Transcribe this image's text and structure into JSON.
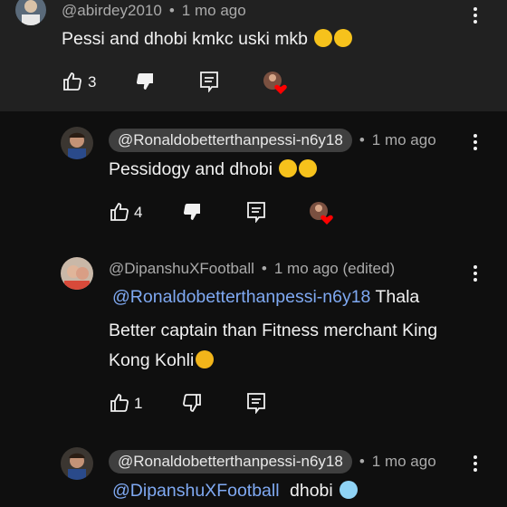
{
  "comment_top": {
    "author": "@abirdey2010",
    "time": "1 mo ago",
    "text": "Pessi and dhobi kmkc uski mkb",
    "likes": "3",
    "emojis": "laughing-crying x2"
  },
  "reply1": {
    "author": "@Ronaldobetterthanpessi-n6y18",
    "time": "1 mo ago",
    "text": "Pessidogy and dhobi",
    "likes": "4"
  },
  "reply2": {
    "author": "@DipanshuXFootball",
    "time": "1 mo ago (edited)",
    "mention": "@Ronaldobetterthanpessi-n6y18",
    "text_after_mention": " Thala",
    "line2": "Better captain than Fitness merchant King",
    "line3": "Kong Kohli",
    "likes": "1"
  },
  "reply3": {
    "author": "@Ronaldobetterthanpessi-n6y18",
    "time": "1 mo ago",
    "mention": "@DipanshuXFootball",
    "text": "dhobi"
  },
  "icons": {
    "like": "thumbs-up-icon",
    "dislike": "thumbs-down-icon",
    "reply": "reply-icon",
    "menu": "more-vertical-icon",
    "creator_heart": "creator-heart-icon"
  },
  "colors": {
    "background": "#0f0f0f",
    "highlight_bg": "#212121",
    "chip_bg": "#3f3f3f",
    "mention": "#7fa9f2",
    "heart": "#ff0000"
  }
}
